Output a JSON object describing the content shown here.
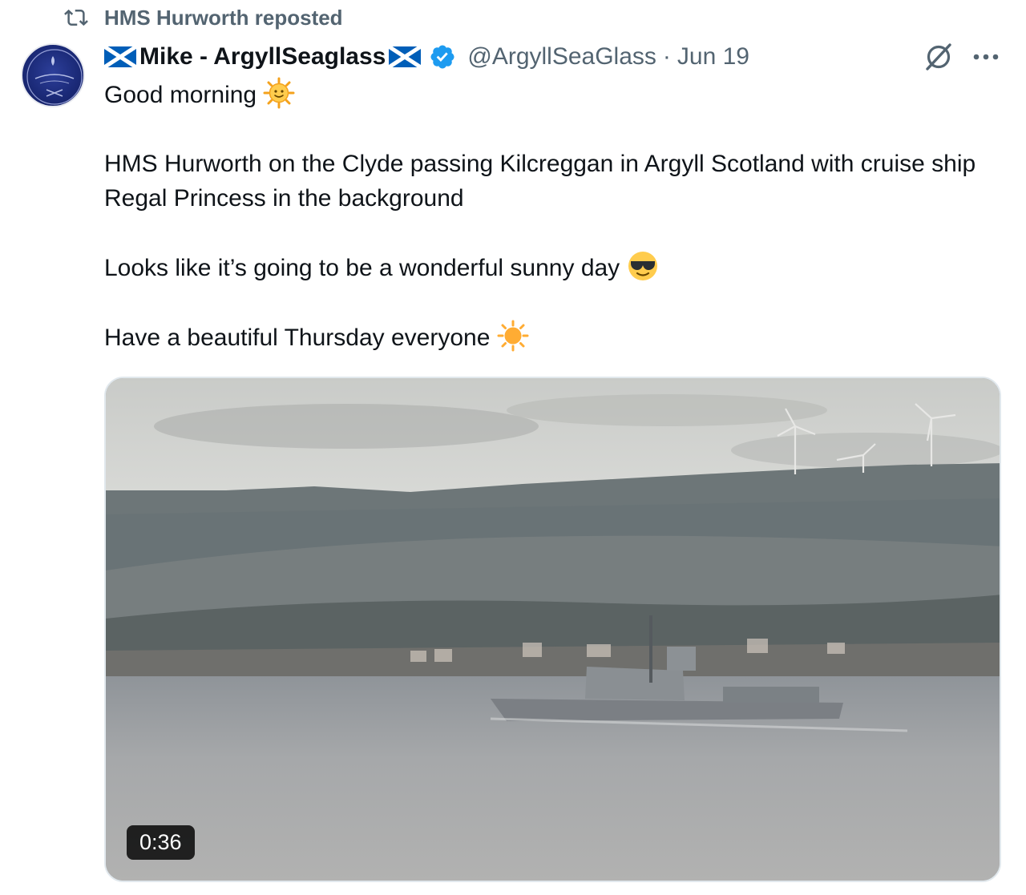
{
  "repost": {
    "label": "HMS Hurworth reposted",
    "icon": "repost-icon"
  },
  "author": {
    "display_name": "Mike - ArgyllSeaglass",
    "handle": "@ArgyllSeaGlass",
    "separator": "·",
    "date": "Jun 19",
    "verified": true,
    "flag_icon": "scotland-flag-icon"
  },
  "tweet": {
    "greeting": "Good morning",
    "line1": "HMS Hurworth on the Clyde passing Kilcreggan in Argyll Scotland with cruise ship Regal Princess in the background",
    "line2": "Looks like it’s going to be a wonderful sunny day",
    "line3": "Have a beautiful Thursday everyone"
  },
  "media": {
    "type": "video",
    "duration": "0:36"
  },
  "colors": {
    "text": "#0f1419",
    "secondary": "#536471",
    "verified_blue": "#1d9bf0",
    "flag_blue": "#005eb8"
  }
}
